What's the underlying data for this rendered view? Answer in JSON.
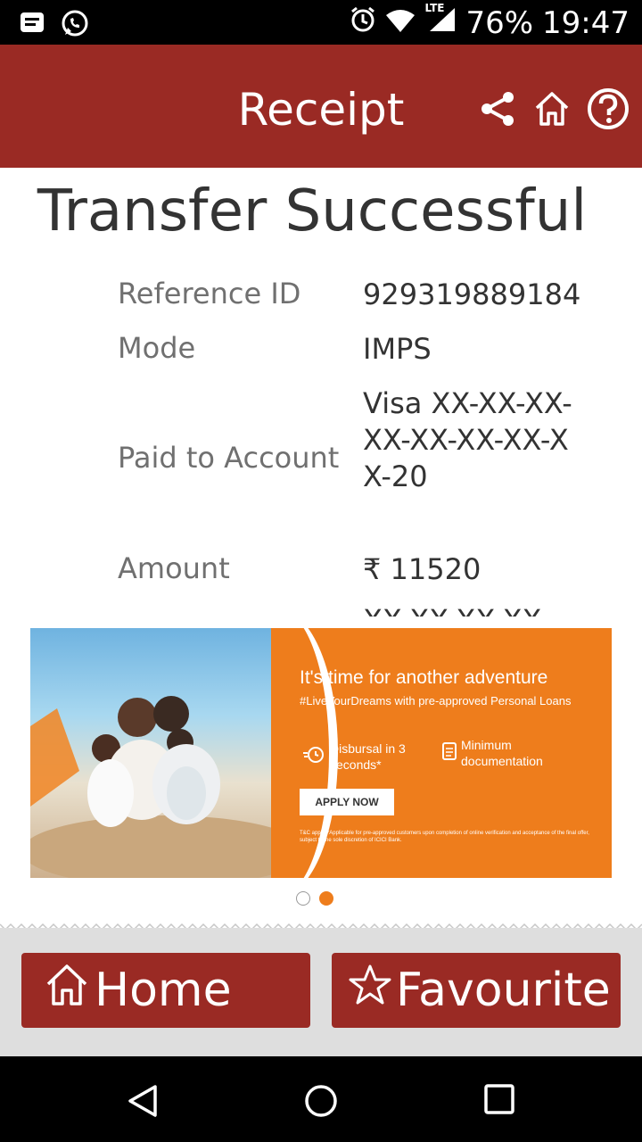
{
  "status_bar": {
    "battery": "76%",
    "time": "19:47",
    "network": "LTE"
  },
  "app_bar": {
    "title": "Receipt"
  },
  "receipt": {
    "heading": "Transfer Successful",
    "rows": [
      {
        "label": "Reference ID",
        "value": "929319889184"
      },
      {
        "label": "Mode",
        "value": "IMPS"
      },
      {
        "label": "Paid to Account",
        "value": "Visa XX-XX-XX-XX-XX-XX-XX-XX-20"
      },
      {
        "label": "Amount",
        "value": "₹ 11520"
      },
      {
        "label": "",
        "value": "XX-XX-XX-XX"
      }
    ]
  },
  "banner": {
    "title": "It's time for another adventure",
    "subtitle": "#LiveYourDreams with pre-approved Personal Loans",
    "feature1": "Disbursal in 3 seconds*",
    "feature2": "Minimum documentation",
    "cta": "APPLY NOW",
    "note": "T&C apply. *Applicable for pre-approved customers upon completion of online verification and acceptance of the final offer, subject to the sole discretion of ICICI Bank."
  },
  "carousel": {
    "current": 2,
    "total": 2
  },
  "bottom_buttons": {
    "home": "Home",
    "favourite": "Favourite"
  },
  "colors": {
    "brand": "#9a2a24",
    "accent": "#ee7d1c",
    "background_bottom": "#dedede"
  },
  "icons": [
    "message-icon",
    "whatsapp-icon",
    "alarm-icon",
    "wifi-icon",
    "signal-icon",
    "share-icon",
    "home-icon",
    "help-icon",
    "star-icon",
    "back-icon",
    "home-nav-icon",
    "recents-icon"
  ]
}
